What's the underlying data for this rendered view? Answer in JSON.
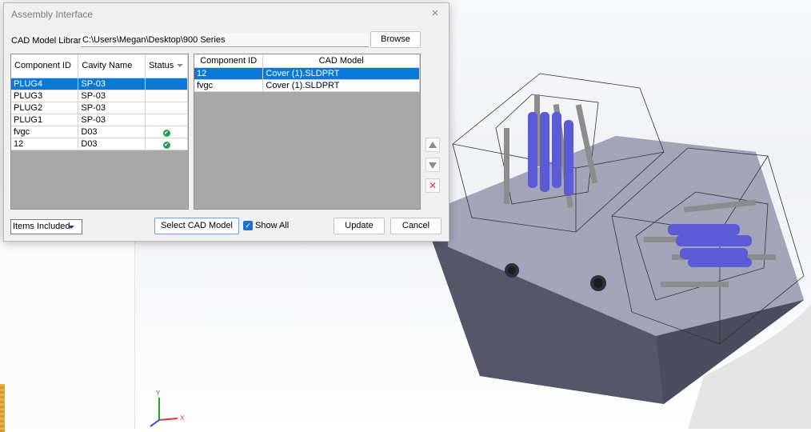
{
  "dialog": {
    "title": "Assembly Interface",
    "close_glyph": "×",
    "library_label": "CAD Model Library",
    "library_path": "C:\\Users\\Megan\\Desktop\\900 Series",
    "browse_label": "Browse",
    "left_table": {
      "headers": [
        "Component ID",
        "Cavity Name",
        "Status"
      ],
      "rows": [
        {
          "id": "PLUG4",
          "cavity": "SP-03",
          "status": ""
        },
        {
          "id": "PLUG3",
          "cavity": "SP-03",
          "status": ""
        },
        {
          "id": "PLUG2",
          "cavity": "SP-03",
          "status": ""
        },
        {
          "id": "PLUG1",
          "cavity": "SP-03",
          "status": ""
        },
        {
          "id": "fvgc",
          "cavity": "D03",
          "status": "check-icon"
        },
        {
          "id": "12",
          "cavity": "D03",
          "status": "check-icon"
        }
      ],
      "selected_row": 0
    },
    "right_table": {
      "headers": [
        "Component ID",
        "CAD Model"
      ],
      "rows": [
        {
          "id": "12",
          "model": "Cover (1).SLDPRT"
        },
        {
          "id": "fvgc",
          "model": "Cover (1).SLDPRT"
        }
      ],
      "selected_row": 0
    },
    "filter_dropdown": "Items Included",
    "select_cad_label": "Select CAD Model",
    "show_all_label": "Show All",
    "show_all_checked": true,
    "update_label": "Update",
    "cancel_label": "Cancel",
    "side_buttons": [
      "move-up-icon",
      "move-down-icon",
      "delete-icon"
    ]
  },
  "triad": {
    "y_label": "Y",
    "x_label": "X"
  },
  "colors": {
    "selection": "#0a78d7",
    "check": "#22a14a",
    "pin_blue": "#5b5bd6",
    "pin_gray": "#8c8c8c",
    "block": "#5d5e72"
  }
}
